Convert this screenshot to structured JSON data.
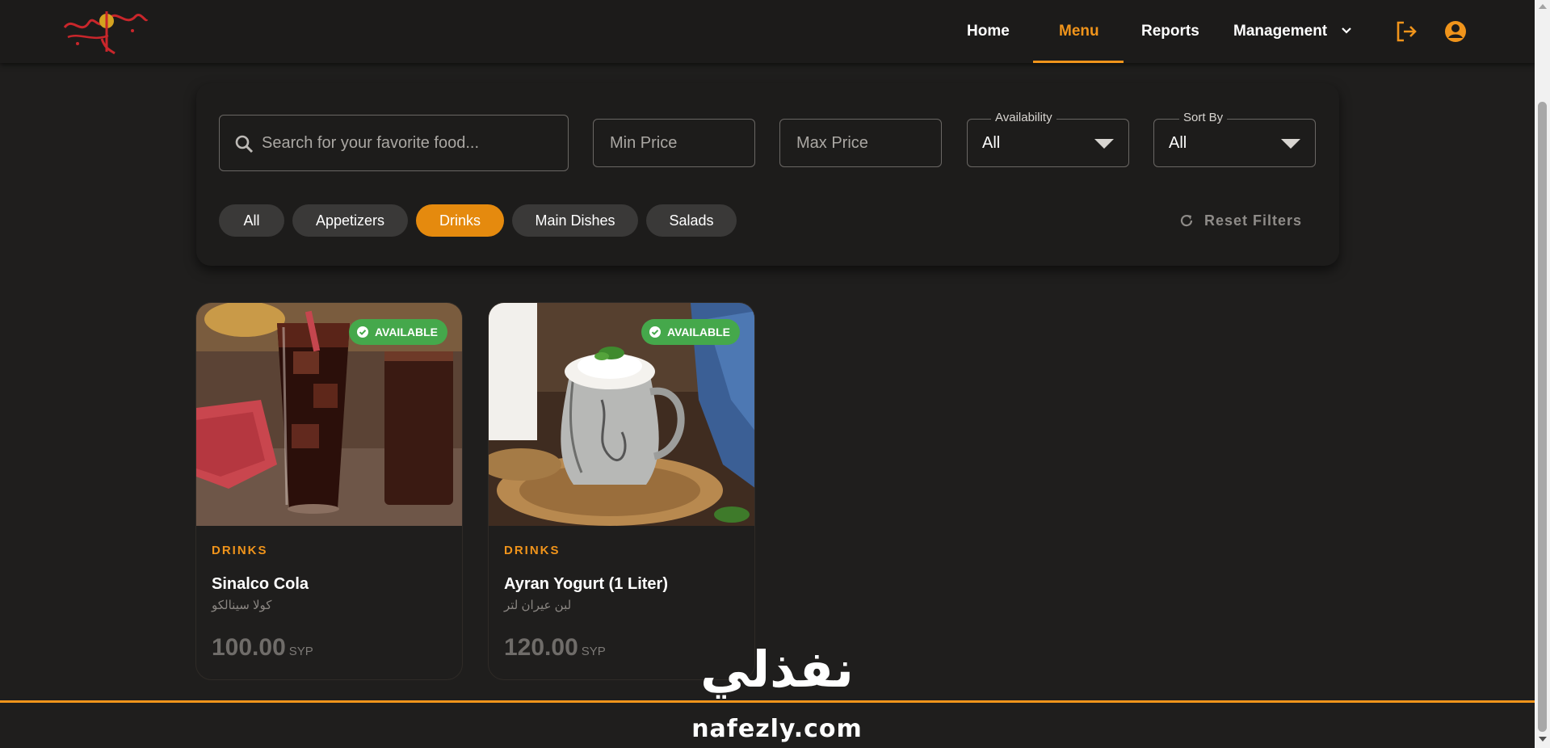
{
  "header": {
    "nav": [
      {
        "label": "Home",
        "active": false
      },
      {
        "label": "Menu",
        "active": true
      },
      {
        "label": "Reports",
        "active": false
      },
      {
        "label": "Management",
        "active": false
      }
    ],
    "icons": [
      "logout-icon",
      "account-circle-icon",
      "chevron-down-icon"
    ],
    "accent_color": "#f0941b"
  },
  "filters": {
    "search": {
      "placeholder": "Search for your favorite food...",
      "value": ""
    },
    "min_price": {
      "placeholder": "Min Price",
      "value": ""
    },
    "max_price": {
      "placeholder": "Max Price",
      "value": ""
    },
    "availability": {
      "label": "Availability",
      "value": "All"
    },
    "sort_by": {
      "label": "Sort By",
      "value": "All"
    },
    "categories": [
      {
        "label": "All",
        "active": false
      },
      {
        "label": "Appetizers",
        "active": false
      },
      {
        "label": "Drinks",
        "active": true
      },
      {
        "label": "Main Dishes",
        "active": false
      },
      {
        "label": "Salads",
        "active": false
      }
    ],
    "reset_label": "Reset Filters"
  },
  "items": [
    {
      "badge": "AVAILABLE",
      "category": "DRINKS",
      "name": "Sinalco Cola",
      "name_ar": "كولا سينالكو",
      "price": "100.00",
      "currency": "SYP"
    },
    {
      "badge": "AVAILABLE",
      "category": "DRINKS",
      "name": "Ayran Yogurt (1 Liter)",
      "name_ar": "لبن عيران لتر",
      "price": "120.00",
      "currency": "SYP"
    }
  ],
  "watermark": {
    "arabic": "نفذلي",
    "latin": "nafezly.com"
  },
  "colors": {
    "background": "#1f1e1d",
    "available_badge": "#45a84b",
    "accent": "#f0941b"
  }
}
